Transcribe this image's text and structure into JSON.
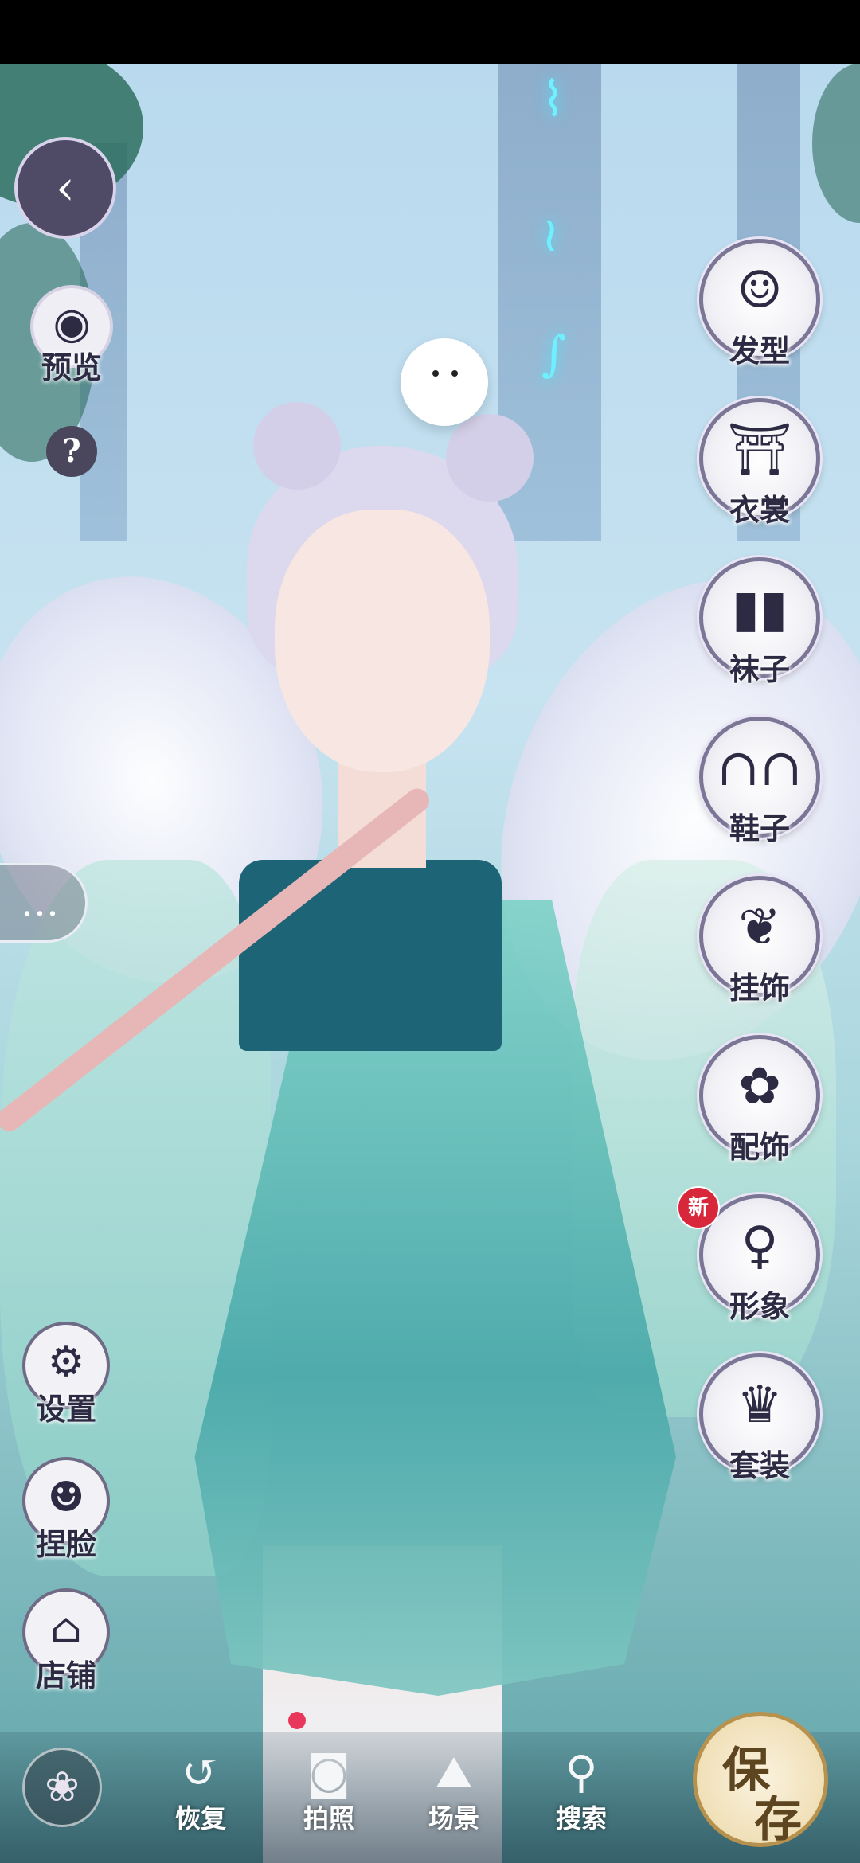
{
  "right_menu": [
    {
      "label": "发型",
      "icon": "hairstyle-icon",
      "glyph": "☺"
    },
    {
      "label": "衣裳",
      "icon": "outfit-icon",
      "glyph": "⛩"
    },
    {
      "label": "袜子",
      "icon": "socks-icon",
      "glyph": "▮▮"
    },
    {
      "label": "鞋子",
      "icon": "shoes-icon",
      "glyph": "∩∩"
    },
    {
      "label": "挂饰",
      "icon": "pendant-icon",
      "glyph": "❦"
    },
    {
      "label": "配饰",
      "icon": "accessory-icon",
      "glyph": "✿"
    },
    {
      "label": "形象",
      "icon": "appearance-icon",
      "glyph": "♀"
    },
    {
      "label": "套装",
      "icon": "set-icon",
      "glyph": "♛"
    }
  ],
  "new_badge": "新",
  "left_buttons": {
    "back_glyph": "‹",
    "preview_label": "预览",
    "preview_glyph": "◉",
    "help_glyph": "?",
    "chat_glyph": "…",
    "settings_label": "设置",
    "settings_glyph": "⚙",
    "face_label": "捏脸",
    "face_glyph": "☻",
    "shop_label": "店铺",
    "shop_glyph": "⌂"
  },
  "bottom_bar": {
    "lotus_glyph": "❀",
    "items": [
      {
        "label": "恢复",
        "icon": "restore-icon",
        "glyph": "↺"
      },
      {
        "label": "拍照",
        "icon": "camera-icon",
        "glyph": "◙"
      },
      {
        "label": "场景",
        "icon": "scene-icon",
        "glyph": "⛰"
      },
      {
        "label": "搜索",
        "icon": "search-icon",
        "glyph": "⚲"
      }
    ],
    "save_top": "保",
    "save_bottom": "存"
  }
}
